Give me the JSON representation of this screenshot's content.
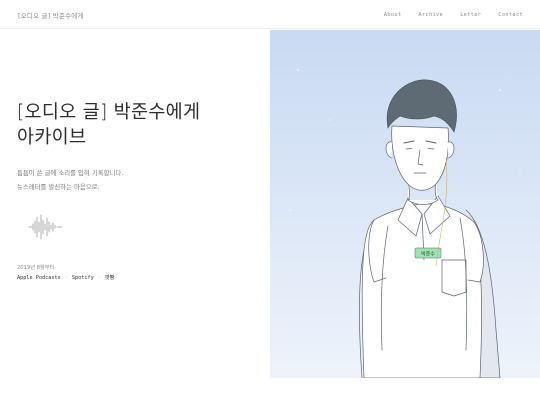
{
  "header": {
    "site_title": "[오디오 글] 박준수에게",
    "nav": [
      {
        "label": "About"
      },
      {
        "label": "Archive"
      },
      {
        "label": "Letter"
      },
      {
        "label": "Contact"
      }
    ]
  },
  "hero": {
    "title_line1": "[오디오 글] 박준수에게",
    "title_line2": "아카이브",
    "desc_line1": "틈틈이 쓴 글에 소리를 입혀 기록합니다.",
    "desc_line2": "뉴스레터를 발신하는 마음으로.",
    "since": "2019년 8월부터",
    "links": [
      {
        "label": "Apple Podcasts"
      },
      {
        "label": "Spotify"
      },
      {
        "label": "팟빵"
      }
    ]
  },
  "illustration": {
    "name_tag": "박준수"
  },
  "colors": {
    "sky_top": "#c9daf2",
    "sky_bottom": "#eef3fb",
    "name_tag": "#9fe3b0"
  }
}
